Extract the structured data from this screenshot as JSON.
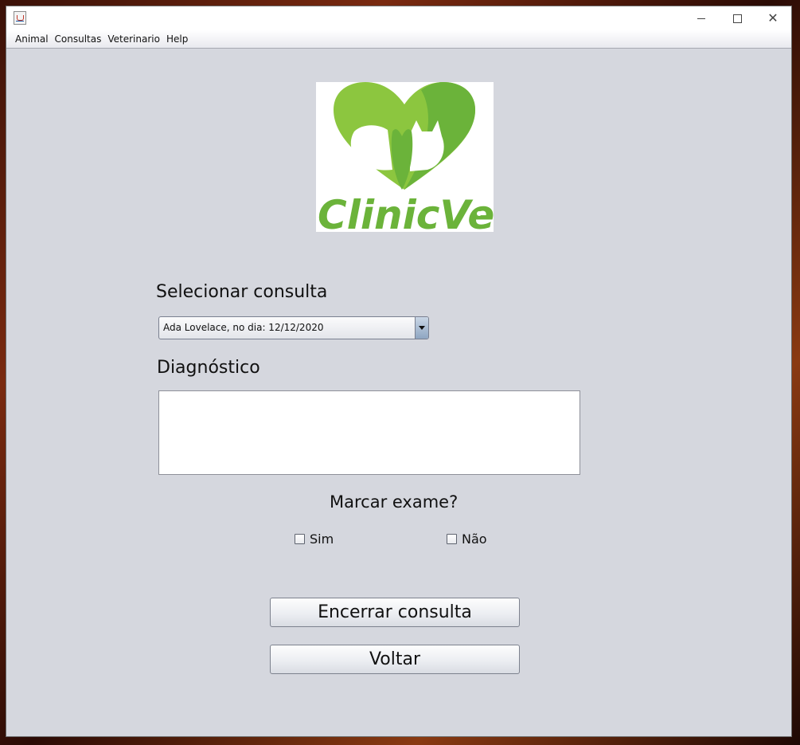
{
  "window": {
    "title": "",
    "controls": {
      "minimize_icon": "minimize-icon",
      "maximize_icon": "maximize-icon",
      "close_icon": "close-icon"
    }
  },
  "menu": {
    "items": [
      "Animal",
      "Consultas",
      "Veterinario",
      "Help"
    ]
  },
  "logo": {
    "text": "ClinicVet",
    "brand_color": "#6bb33a",
    "light_color": "#8cc63f"
  },
  "form": {
    "select_label": "Selecionar consulta",
    "select_value": "Ada Lovelace, no dia: 12/12/2020",
    "diagnosis_label": "Diagnóstico",
    "diagnosis_value": "",
    "exam_question": "Marcar exame?",
    "option_yes": "Sim",
    "option_no": "Não"
  },
  "buttons": {
    "close_consultation": "Encerrar consulta",
    "back": "Voltar"
  }
}
